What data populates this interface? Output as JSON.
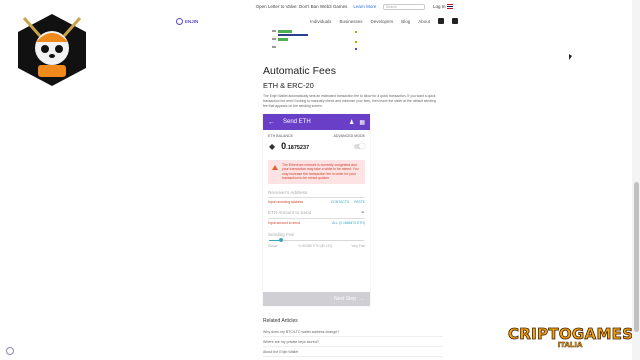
{
  "notice": {
    "text": "Open Letter to Valve: Don't Ban Web3 Games",
    "link": "Learn More"
  },
  "header": {
    "logo": "ENJIN",
    "nav": [
      "Individuals",
      "Businesses",
      "Developers",
      "Blog",
      "About"
    ],
    "search_placeholder": "Search",
    "login": "Log In"
  },
  "article": {
    "title": "Automatic Fees",
    "subtitle": "ETH & ERC-20",
    "body": "The Enjin Wallet automatically sets an estimated transaction fee to allow for a quick transaction. If you want a quick transaction but aren't looking to manually check and minimize your fees, then leave the slider at the default sending fee that appears on the sending screen."
  },
  "phone": {
    "header_title": "Send ETH",
    "balance_label": "ETH BALANCE",
    "advanced_label": "ADVANCED MODE",
    "balance_int": "0",
    "balance_dec": ".1875237",
    "warning": "The Ethereum network is currently congested and your transaction may take a while to be mined. You may increase the transaction fee in order for your transaction to be mined quicker",
    "receiver_label": "Receiver's Address",
    "receiver_hint": "Input receiving address",
    "contacts": "CONTACTS",
    "paste": "PASTE",
    "amount_label": "ETH Amount to Send",
    "amount_hint": "Input amount to send",
    "all_value": "ALL (0.1868472 ETH)",
    "fee_label": "Sending Fee",
    "slider_level": 0.12,
    "fee_slower": "Slower",
    "fee_value": "~0.000082 ETH ($0.191)",
    "fee_faster": "Very Fast",
    "next": "Next Step",
    "accent": "#6a3fc7"
  },
  "related": {
    "heading": "Related Articles",
    "items": [
      "Why does my BTC/LTC wallet address change?",
      "Where are my private keys stored?",
      "About the Enjin Wallet"
    ]
  },
  "brand": {
    "top": "CRIPTOGAMES",
    "bottom": "ITALIA",
    "color": "#f5a312"
  }
}
